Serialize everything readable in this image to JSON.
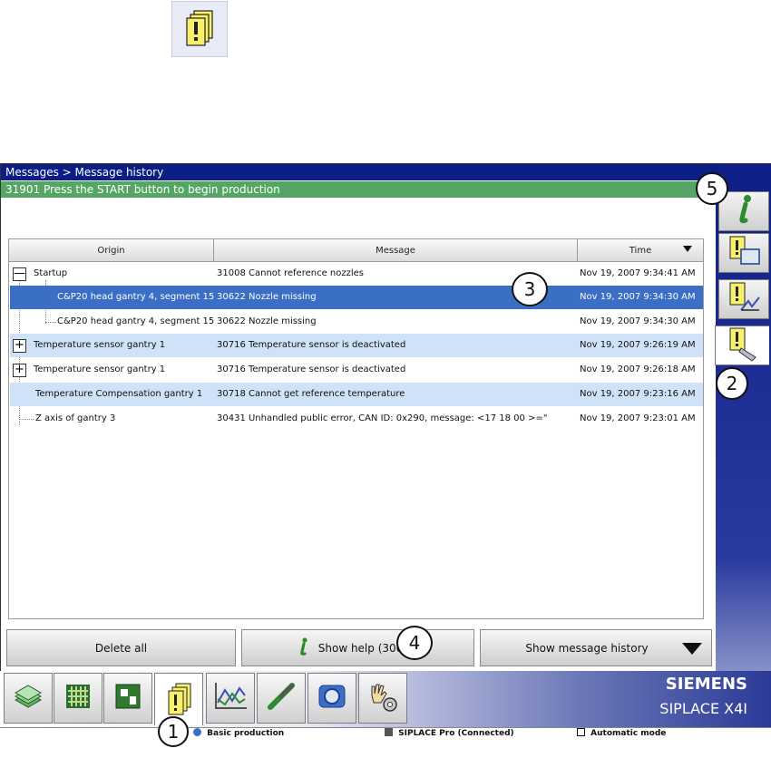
{
  "window": {
    "breadcrumb": "Messages > Message history",
    "current_message": "31901 Press the START button to begin production"
  },
  "table": {
    "columns": [
      "Origin",
      "Message",
      "Time"
    ],
    "rows": [
      {
        "expander": "—",
        "origin": "Startup",
        "message": "31008 Cannot reference nozzles",
        "time": "Nov 19, 2007 9:34:41 AM"
      },
      {
        "expander": "",
        "origin": "C&P20 head gantry 4, segment 15",
        "message": "30622 Nozzle missing",
        "time": "Nov 19, 2007 9:34:30 AM"
      },
      {
        "expander": "",
        "origin": "C&P20 head gantry 4, segment 15",
        "message": "30622 Nozzle missing",
        "time": "Nov 19, 2007 9:34:30 AM"
      },
      {
        "expander": "+",
        "origin": "Temperature sensor gantry 1",
        "message": "30716 Temperature sensor is deactivated",
        "time": "Nov 19, 2007 9:26:19 AM"
      },
      {
        "expander": "+",
        "origin": "Temperature sensor gantry 1",
        "message": "30716 Temperature sensor is deactivated",
        "time": "Nov 19, 2007 9:26:18 AM"
      },
      {
        "expander": "",
        "origin": "Temperature Compensation gantry 1",
        "message": "30718 Cannot get reference temperature",
        "time": "Nov 19, 2007 9:23:16 AM"
      },
      {
        "expander": "",
        "origin": "Z axis of gantry 3",
        "message": "30431 Unhandled public error, CAN ID: 0x290, message: <17 18 00 >=\"",
        "time": "Nov 19, 2007 9:23:01 AM"
      }
    ],
    "selected_row": 1
  },
  "buttons": {
    "delete_all": "Delete all",
    "show_help": "Show help (30622)",
    "show_history": "Show message history"
  },
  "brand": {
    "company": "SIEMENS",
    "product": "SIPLACE X4I"
  },
  "status": {
    "mode": "Basic production",
    "connection": "SIPLACE Pro (Connected)",
    "operation": "Automatic mode"
  },
  "callouts": [
    "1",
    "2",
    "3",
    "4",
    "5"
  ],
  "icons": {
    "sidebar": [
      "info-icon",
      "message-monitor-icon",
      "message-chart-icon",
      "message-history-icon"
    ],
    "toolbar": [
      "stack-icon",
      "grid-icon",
      "board-icon",
      "messages-icon",
      "statistics-icon",
      "nozzle-icon",
      "camera-icon",
      "service-icon"
    ]
  },
  "colors": {
    "title_bar": "#0a1e86",
    "message_bar": "#55a564",
    "selected_row": "#3a6fc5",
    "highlight_row": "#cfe2f8"
  }
}
